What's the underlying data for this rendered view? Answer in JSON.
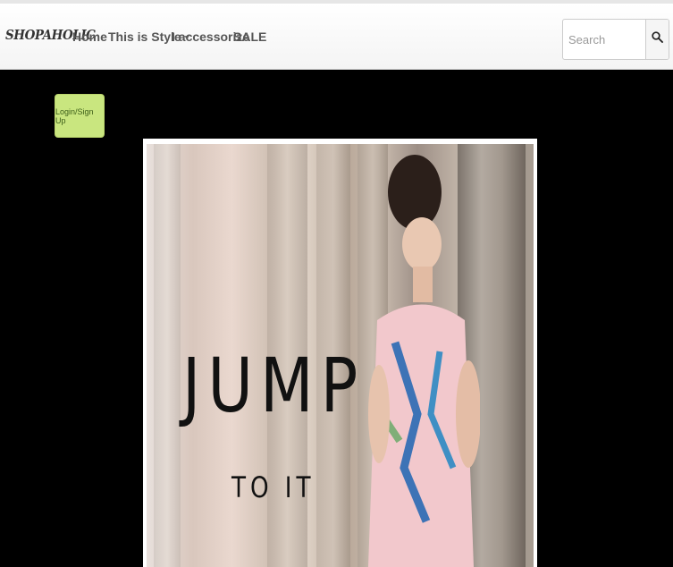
{
  "brand": "SHOPAHOLIC",
  "nav": {
    "items": [
      {
        "label": "Home"
      },
      {
        "label": "This is Style",
        "dropdown": true
      },
      {
        "label": "I accessorize"
      },
      {
        "label": "SALE"
      }
    ]
  },
  "search": {
    "placeholder": "Search",
    "icon": "search-icon"
  },
  "login_button": "Login/Sign Up",
  "banner": {
    "headline": "JUMP",
    "subline": "TO IT"
  },
  "colors": {
    "login_button": "#c9e67f",
    "page_background": "#000000",
    "navbar": "#f8f8f8"
  }
}
